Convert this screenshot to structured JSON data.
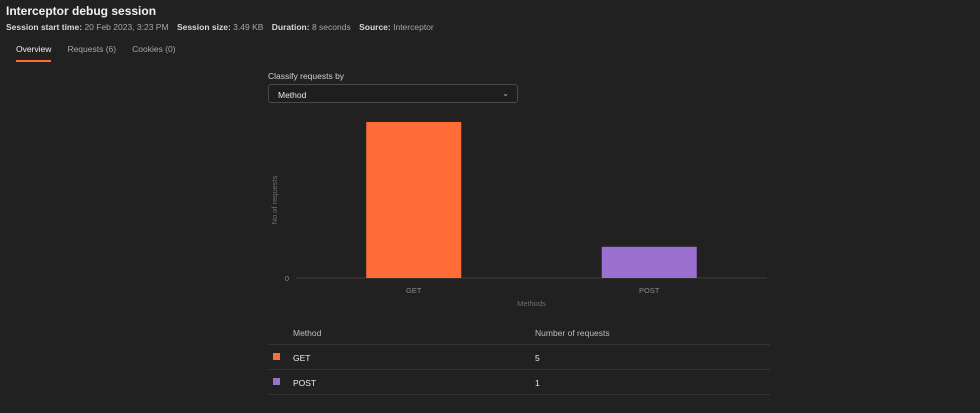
{
  "header": {
    "title": "Interceptor debug session",
    "meta": [
      {
        "label": "Session start time:",
        "value": "20 Feb 2023, 3:23 PM"
      },
      {
        "label": "Session size:",
        "value": "3.49 KB"
      },
      {
        "label": "Duration:",
        "value": "8 seconds"
      },
      {
        "label": "Source:",
        "value": "Interceptor"
      }
    ]
  },
  "tabs": [
    {
      "label": "Overview"
    },
    {
      "label": "Requests (6)"
    },
    {
      "label": "Cookies (0)"
    }
  ],
  "classify": {
    "label": "Classify requests by",
    "selected": "Method",
    "chevron_icon": "chevron-down-icon"
  },
  "chart_data": {
    "type": "bar",
    "categories": [
      "GET",
      "POST"
    ],
    "values": [
      5,
      1
    ],
    "colors": [
      "#ff6c37",
      "#9b6fcf"
    ],
    "xlabel": "Methods",
    "ylabel": "No of requests",
    "yticks": [
      "0"
    ],
    "ylim": [
      0,
      5
    ],
    "grid": false
  },
  "table": {
    "headers": [
      "Method",
      "Number of requests"
    ],
    "rows": [
      {
        "method": "GET",
        "count": "5",
        "color": "#ff6c37"
      },
      {
        "method": "POST",
        "count": "1",
        "color": "#9b6fcf"
      }
    ]
  }
}
